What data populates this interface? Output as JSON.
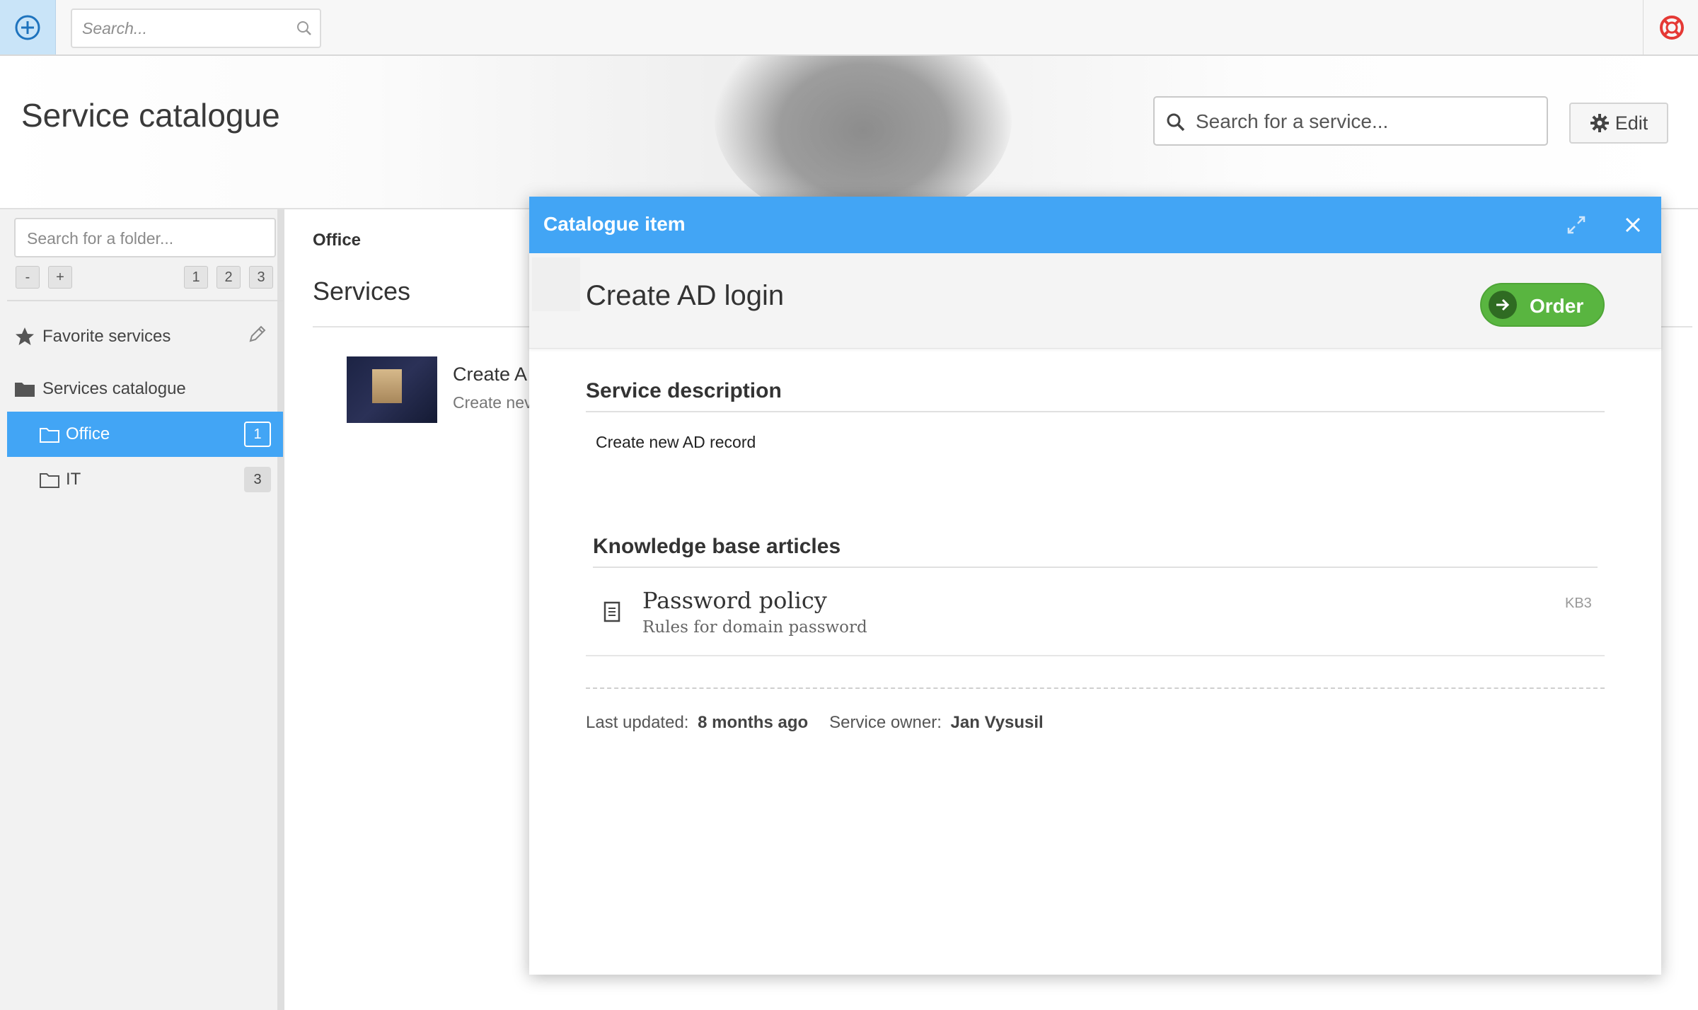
{
  "topbar": {
    "search_placeholder": "Search..."
  },
  "header": {
    "title": "Service catalogue",
    "service_search_placeholder": "Search for a service...",
    "edit_label": "Edit"
  },
  "sidebar": {
    "folder_search_placeholder": "Search for a folder...",
    "collapse_label": "-",
    "expand_label": "+",
    "level_buttons": [
      "1",
      "2",
      "3"
    ],
    "favorite_label": "Favorite services",
    "catalogue_label": "Services catalogue",
    "folders": [
      {
        "label": "Office",
        "count": "1",
        "active": true
      },
      {
        "label": "IT",
        "count": "3",
        "active": false
      }
    ]
  },
  "main": {
    "breadcrumb": "Office",
    "heading": "Services",
    "service": {
      "title": "Create A",
      "description": "Create nev"
    }
  },
  "modal": {
    "header_title": "Catalogue item",
    "item_title": "Create AD login",
    "order_label": "Order",
    "description_heading": "Service description",
    "description_text": "Create new AD record",
    "kb_heading": "Knowledge base articles",
    "kb_articles": [
      {
        "title": "Password policy",
        "subtitle": "Rules for domain password",
        "code": "KB3"
      }
    ],
    "last_updated_label": "Last updated:",
    "last_updated_value": "8 months ago",
    "owner_label": "Service owner:",
    "owner_value": "Jan Vysusil"
  },
  "colors": {
    "accent": "#42a5f5",
    "order_green": "#59b540",
    "help_red": "#e53935"
  }
}
